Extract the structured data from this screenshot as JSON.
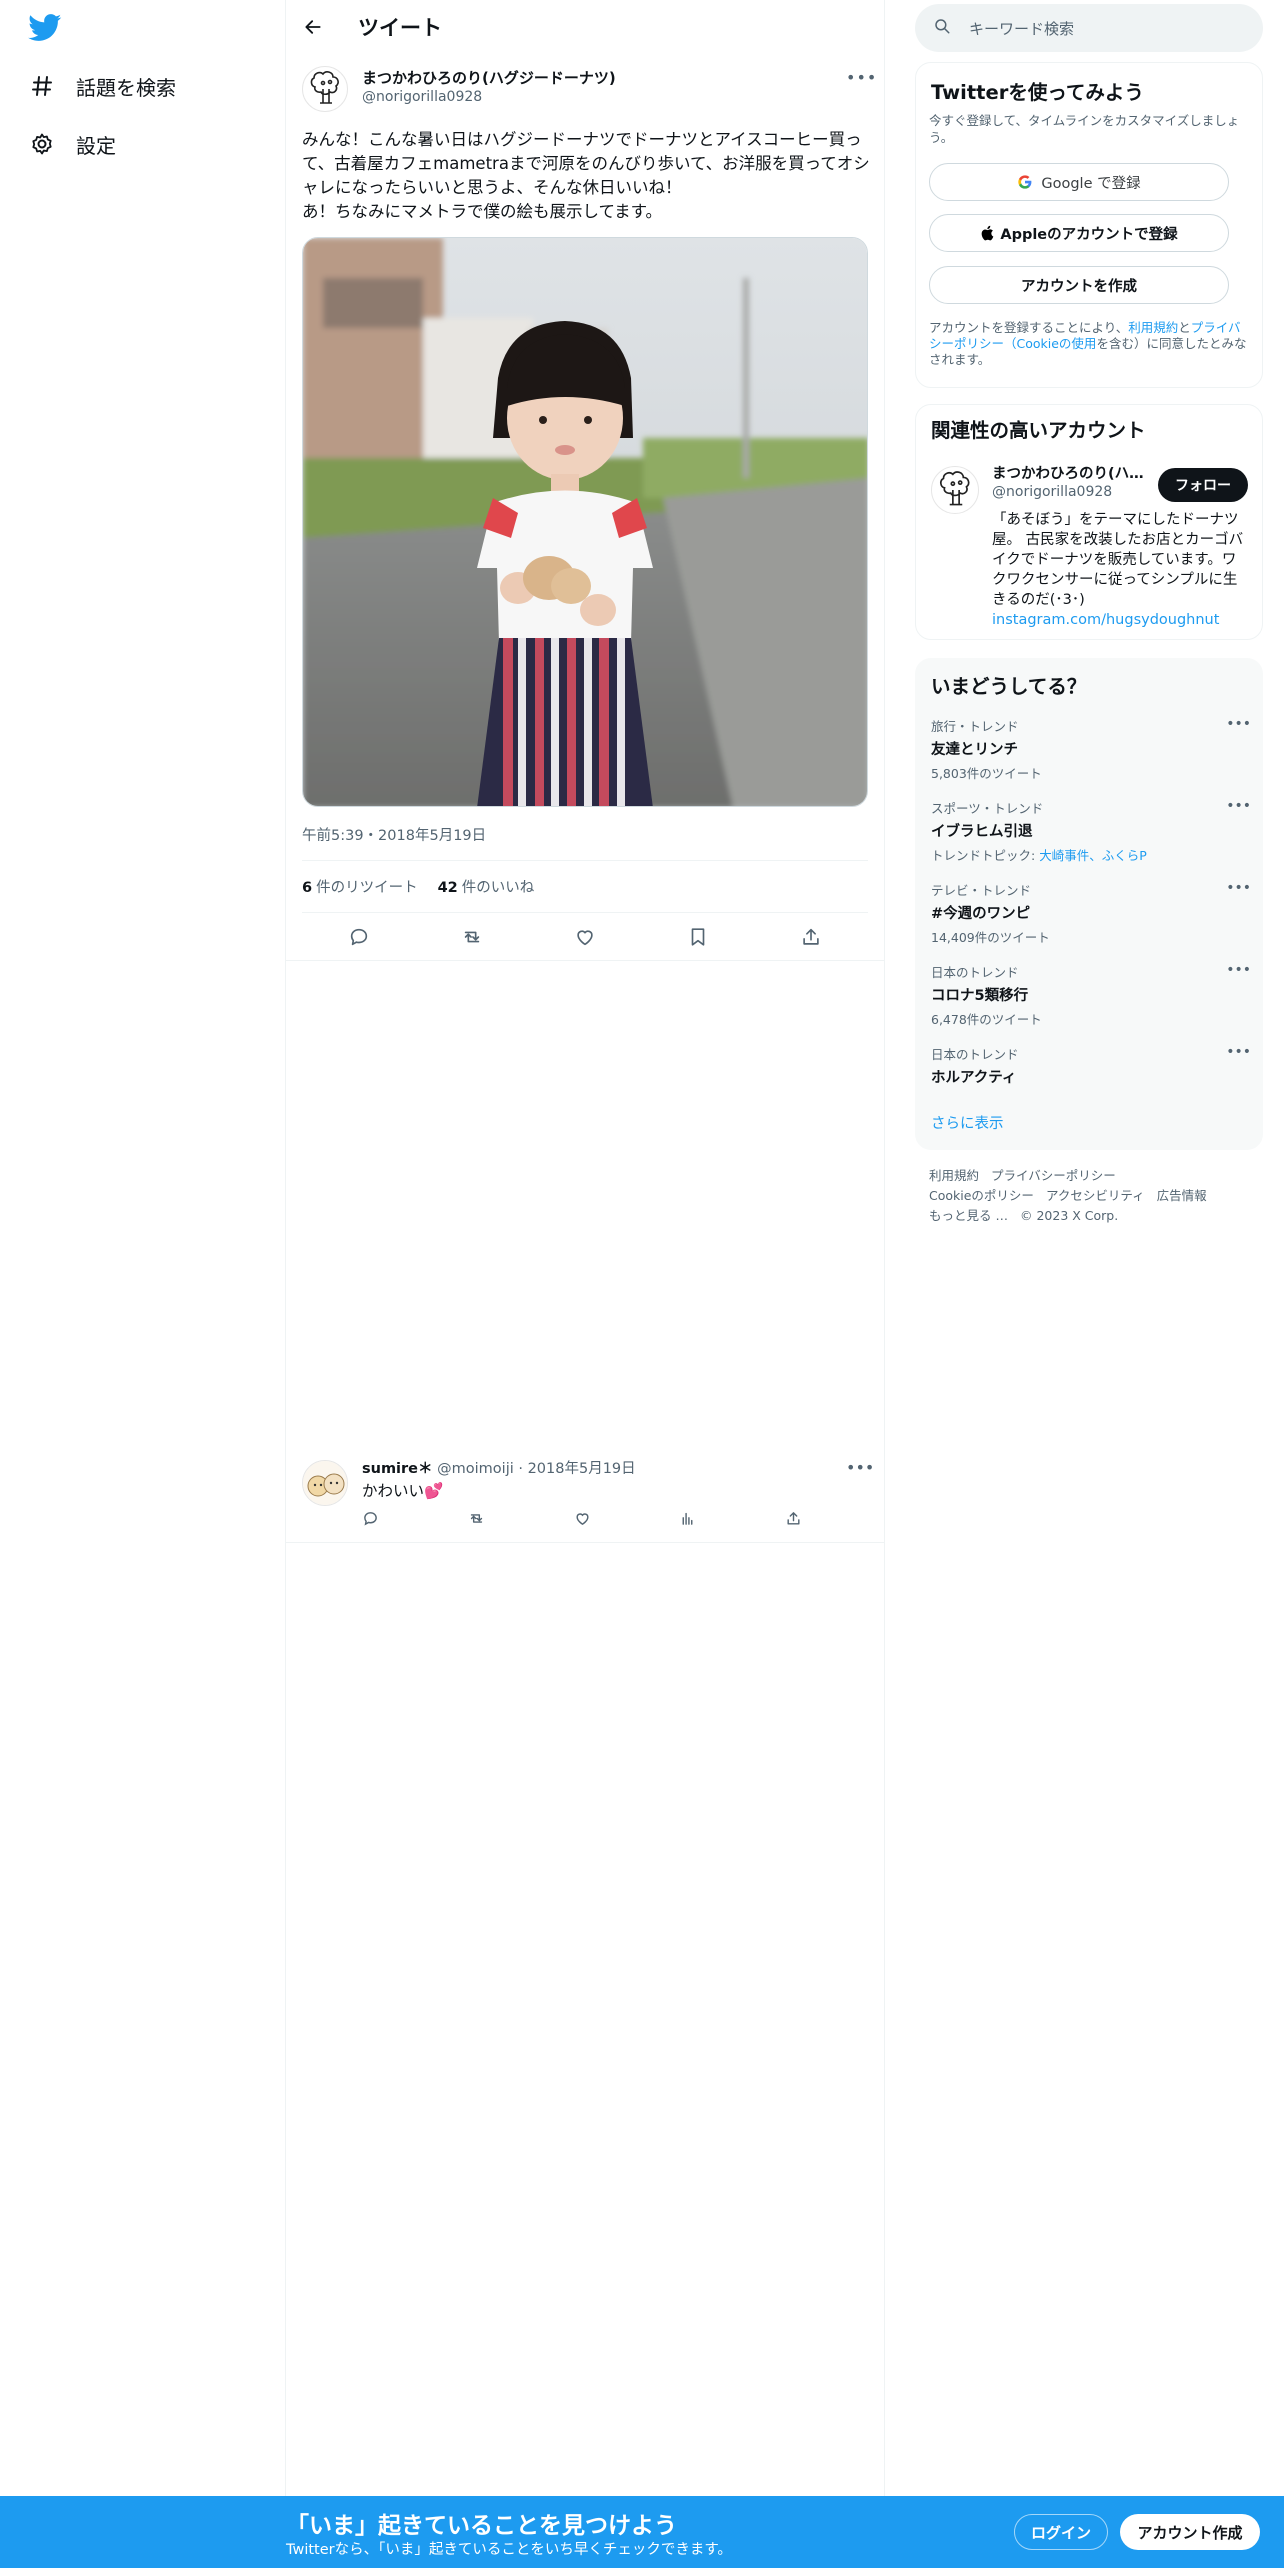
{
  "colors": {
    "brand": "#1d9bf0",
    "text": "#0f1419",
    "muted": "#536471"
  },
  "nav": {
    "logo_icon": "twitter-bird-icon",
    "items": [
      {
        "label": "話題を検索",
        "icon": "hashtag-icon"
      },
      {
        "label": "設定",
        "icon": "gear-icon"
      }
    ]
  },
  "header": {
    "title": "ツイート"
  },
  "tweet": {
    "name": "まつかわひろのり(ハグジードーナツ)",
    "handle": "@norigorilla0928",
    "text": "みんな！こんな暑い日はハグジードーナツでドーナツとアイスコーヒー買って、古着屋カフェmametraまで河原をのんびり歩いて、お洋服を買ってオシャレになったらいいと思うよ、そんな休日いいね！\nあ！ちなみにマメトラで僕の絵も展示してます。",
    "time": "午前5:39・2018年5月19日",
    "retweets": "6",
    "retweets_label": "件のリツイート",
    "likes": "42",
    "likes_label": "件のいいね"
  },
  "reply": {
    "name": "sumire＊",
    "handle": "@moimoiji",
    "date": "2018年5月19日",
    "text": "かわいい💕"
  },
  "search": {
    "placeholder": "キーワード検索"
  },
  "signup": {
    "title": "Twitterを使ってみよう",
    "subtitle": "今すぐ登録して、タイムラインをカスタマイズしましょう。",
    "google": "Google で登録",
    "apple": "Appleのアカウントで登録",
    "create": "アカウントを作成",
    "terms_prefix": "アカウントを登録することにより、",
    "terms_link1": "利用規約",
    "terms_and": "と",
    "terms_link2": "プライバシーポリシー（Cookieの使用",
    "terms_suffix": "を含む）に同意したとみなされます。"
  },
  "related": {
    "title": "関連性の高いアカウント",
    "name": "まつかわひろのり(ハグジードーナツ)",
    "handle": "@norigorilla0928",
    "follow": "フォロー",
    "bio": "「あそぼう」をテーマにしたドーナツ屋。 古民家を改装したお店とカーゴバイクでドーナツを販売しています。ワクワクセンサーに従ってシンプルに生きるのだ(･3･)",
    "link": "instagram.com/hugsydoughnut"
  },
  "trends": {
    "title": "いまどうしてる？",
    "items": [
      {
        "category": "旅行・トレンド",
        "title": "友達とリンチ",
        "count": "5,803件のツイート"
      },
      {
        "category": "スポーツ・トレンド",
        "title": "イブラヒム引退",
        "topic_label": "トレンドトピック: ",
        "topic": "大崎事件、ふくらP"
      },
      {
        "category": "テレビ・トレンド",
        "title": "#今週のワンピ",
        "count": "14,409件のツイート"
      },
      {
        "category": "日本のトレンド",
        "title": "コロナ5類移行",
        "count": "6,478件のツイート"
      },
      {
        "category": "日本のトレンド",
        "title": "ホルアクティ"
      }
    ],
    "show_more": "さらに表示"
  },
  "footer": {
    "terms": "利用規約",
    "privacy": "プライバシーポリシー",
    "cookie": "Cookieのポリシー",
    "accessibility": "アクセシビリティ",
    "ads": "広告情報",
    "more": "もっと見る …",
    "copyright": "© 2023 X Corp."
  },
  "bottom_bar": {
    "title": "「いま」起きていることを見つけよう",
    "subtitle": "Twitterなら、「いま」起きていることをいち早くチェックできます。",
    "login": "ログイン",
    "signup": "アカウント作成"
  }
}
